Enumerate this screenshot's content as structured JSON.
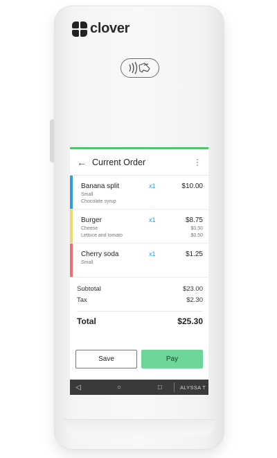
{
  "brand": {
    "name": "clover"
  },
  "screen": {
    "title": "Current Order",
    "icons": {
      "back": "arrow-left-icon",
      "more": "more-vertical-icon"
    },
    "items": [
      {
        "name": "Banana split",
        "qty": "x1",
        "price": "$10.00",
        "color": "#2aa3d9",
        "modifiers": [
          {
            "label": "Small",
            "price": ""
          },
          {
            "label": "Chocolate syrup",
            "price": ""
          }
        ]
      },
      {
        "name": "Burger",
        "qty": "x1",
        "price": "$8.75",
        "color": "#f2d66b",
        "modifiers": [
          {
            "label": "Cheese",
            "price": "$0.50"
          },
          {
            "label": "Lettuce and tomato",
            "price": "$0.50"
          }
        ]
      },
      {
        "name": "Cherry soda",
        "qty": "x1",
        "price": "$1.25",
        "color": "#ee6f6f",
        "modifiers": [
          {
            "label": "Small",
            "price": ""
          }
        ]
      }
    ],
    "subtotal": {
      "label": "Subtotal",
      "value": "$23.00"
    },
    "tax": {
      "label": "Tax",
      "value": "$2.30"
    },
    "total": {
      "label": "Total",
      "value": "$25.30"
    },
    "buttons": {
      "save": "Save",
      "pay": "Pay"
    },
    "navbar": {
      "user": "ALYSSA T"
    }
  }
}
